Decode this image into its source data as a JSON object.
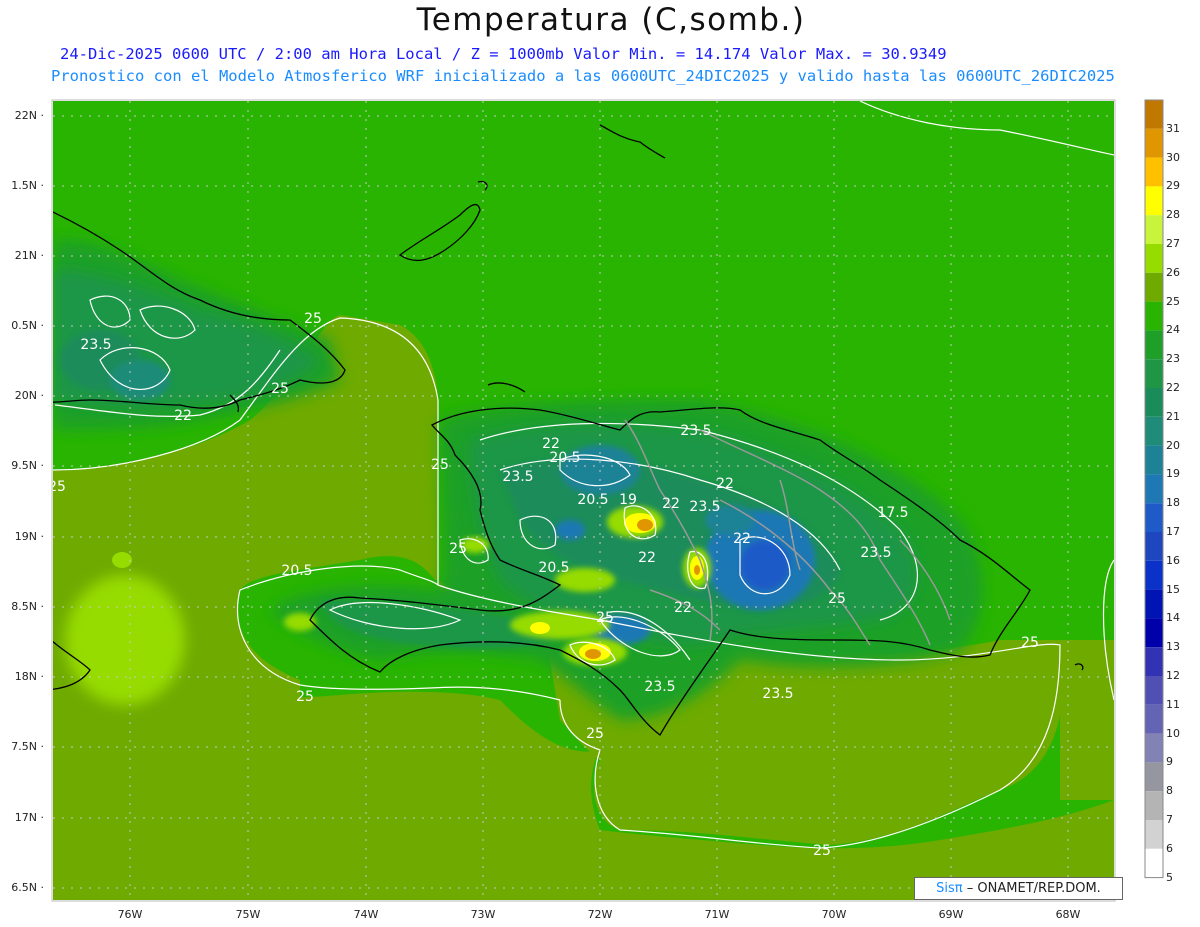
{
  "header": {
    "title": "Temperatura (C,somb.)",
    "line1": "24-Dic-2025  0600 UTC / 2:00 am Hora Local / Z = 1000mb    Valor Min. = 14.174  Valor Max. = 30.9349",
    "line2": "Pronostico con el Modelo Atmosferico WRF inicializado a las 0600UTC_24DIC2025 y valido hasta las  0600UTC_26DIC2025"
  },
  "map": {
    "lat_labels": [
      "22N",
      "1.5N",
      "21N",
      "0.5N",
      "20N",
      "9.5N",
      "19N",
      "8.5N",
      "18N",
      "7.5N",
      "17N",
      "6.5N"
    ],
    "lon_labels": [
      "76W",
      "75W",
      "74W",
      "73W",
      "72W",
      "71W",
      "70W",
      "69W",
      "68W"
    ],
    "contour_labels": [
      "25",
      "23.5",
      "25",
      "22",
      "25",
      "25",
      "22",
      "20.5",
      "23.5",
      "23.5",
      "22",
      "20.5",
      "19",
      "22",
      "23.5",
      "17.5",
      "22",
      "23.5",
      "25",
      "22",
      "20.5",
      "25",
      "22",
      "20.5",
      "25",
      "23.5",
      "23.5",
      "25",
      "25",
      "25"
    ]
  },
  "colorbar": {
    "labels": [
      "31",
      "30",
      "29",
      "28",
      "27",
      "26",
      "25",
      "24",
      "23",
      "22",
      "21",
      "20",
      "19",
      "18",
      "17",
      "16",
      "15",
      "14",
      "13",
      "12",
      "11",
      "10",
      "9",
      "8",
      "7",
      "6",
      "5"
    ],
    "colors": [
      "#c07800",
      "#e09600",
      "#ffc000",
      "#ffff00",
      "#c8f53c",
      "#96dc00",
      "#6eaa00",
      "#28b400",
      "#1ea028",
      "#1e9646",
      "#1a8c5a",
      "#1e8c78",
      "#1e8296",
      "#1e78b4",
      "#1e5ac8",
      "#1e46be",
      "#0a32c8",
      "#0014b4",
      "#0000aa",
      "#3232b4",
      "#5050b4",
      "#6464b4",
      "#8282b4",
      "#9696a0",
      "#b4b4b4",
      "#d2d2d2",
      "#ffffff"
    ]
  },
  "credit": {
    "logo": "Sisπ",
    "text": "– ONAMET/REP.DOM."
  }
}
